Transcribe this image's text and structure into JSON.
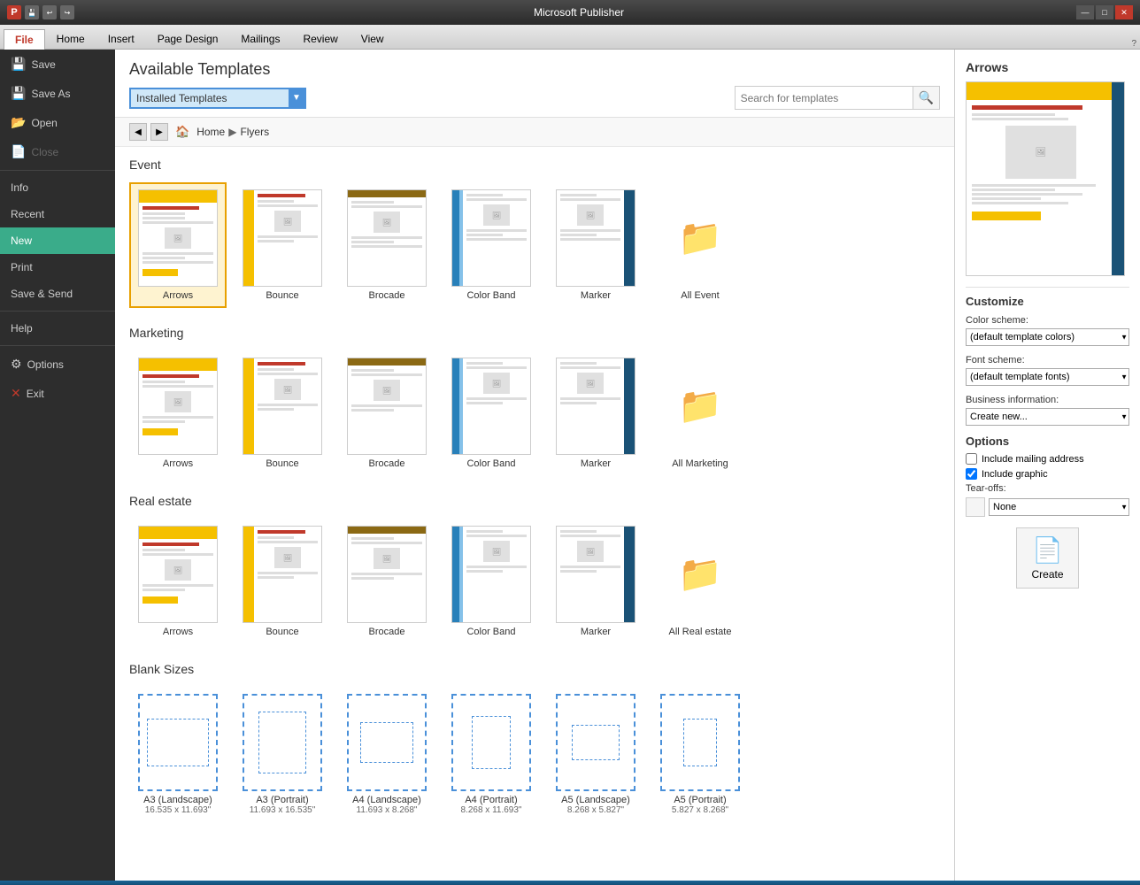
{
  "titlebar": {
    "title": "Microsoft Publisher",
    "app_icon": "P",
    "min_btn": "—",
    "max_btn": "□",
    "close_btn": "✕"
  },
  "ribbon": {
    "tabs": [
      "File",
      "Home",
      "Insert",
      "Page Design",
      "Mailings",
      "Review",
      "View"
    ]
  },
  "sidebar": {
    "items": [
      {
        "id": "save",
        "label": "Save",
        "icon": "💾"
      },
      {
        "id": "save-as",
        "label": "Save As",
        "icon": "💾"
      },
      {
        "id": "open",
        "label": "Open",
        "icon": "📂"
      },
      {
        "id": "close",
        "label": "Close",
        "icon": "📄"
      },
      {
        "id": "info",
        "label": "Info"
      },
      {
        "id": "recent",
        "label": "Recent"
      },
      {
        "id": "new",
        "label": "New",
        "active": true
      },
      {
        "id": "print",
        "label": "Print"
      },
      {
        "id": "save-send",
        "label": "Save & Send"
      },
      {
        "id": "help",
        "label": "Help"
      },
      {
        "id": "options",
        "label": "Options",
        "icon": "⚙"
      },
      {
        "id": "exit",
        "label": "Exit",
        "icon": "✕"
      }
    ]
  },
  "header": {
    "title": "Available Templates",
    "dropdown_selected": "Installed Templates",
    "search_placeholder": "Search for templates",
    "breadcrumb": {
      "home": "Home",
      "separator": "▶",
      "current": "Flyers"
    }
  },
  "categories": [
    {
      "id": "event",
      "label": "Event",
      "templates": [
        {
          "id": "arrows-e",
          "label": "Arrows",
          "type": "arrows",
          "selected": true
        },
        {
          "id": "bounce-e",
          "label": "Bounce",
          "type": "bounce"
        },
        {
          "id": "brocade-e",
          "label": "Brocade",
          "type": "brocade"
        },
        {
          "id": "colorband-e",
          "label": "Color Band",
          "type": "colorband"
        },
        {
          "id": "marker-e",
          "label": "Marker",
          "type": "marker"
        },
        {
          "id": "all-e",
          "label": "All Event",
          "type": "folder"
        }
      ]
    },
    {
      "id": "marketing",
      "label": "Marketing",
      "templates": [
        {
          "id": "arrows-m",
          "label": "Arrows",
          "type": "arrows"
        },
        {
          "id": "bounce-m",
          "label": "Bounce",
          "type": "bounce"
        },
        {
          "id": "brocade-m",
          "label": "Brocade",
          "type": "brocade"
        },
        {
          "id": "colorband-m",
          "label": "Color Band",
          "type": "colorband"
        },
        {
          "id": "marker-m",
          "label": "Marker",
          "type": "marker"
        },
        {
          "id": "all-m",
          "label": "All Marketing",
          "type": "folder"
        }
      ]
    },
    {
      "id": "realestate",
      "label": "Real estate",
      "templates": [
        {
          "id": "arrows-r",
          "label": "Arrows",
          "type": "arrows"
        },
        {
          "id": "bounce-r",
          "label": "Bounce",
          "type": "bounce"
        },
        {
          "id": "brocade-r",
          "label": "Brocade",
          "type": "brocade"
        },
        {
          "id": "colorband-r",
          "label": "Color Band",
          "type": "colorband"
        },
        {
          "id": "marker-r",
          "label": "Marker",
          "type": "marker"
        },
        {
          "id": "all-r",
          "label": "All Real estate",
          "type": "folder"
        }
      ]
    },
    {
      "id": "blank",
      "label": "Blank Sizes",
      "templates": [
        {
          "id": "a3-land",
          "label": "A3 (Landscape)",
          "sublabel": "16.535 x 11.693\"",
          "type": "blank-landscape"
        },
        {
          "id": "a3-port",
          "label": "A3 (Portrait)",
          "sublabel": "11.693 x 16.535\"",
          "type": "blank-portrait"
        },
        {
          "id": "a4-land",
          "label": "A4 (Landscape)",
          "sublabel": "11.693 x 8.268\"",
          "type": "blank-small-landscape"
        },
        {
          "id": "a4-port",
          "label": "A4 (Portrait)",
          "sublabel": "8.268 x 11.693\"",
          "type": "blank-small-portrait"
        },
        {
          "id": "a5-land",
          "label": "A5 (Landscape)",
          "sublabel": "8.268 x 5.827\"",
          "type": "blank-smaller-landscape"
        },
        {
          "id": "a5-port",
          "label": "A5 (Portrait)",
          "sublabel": "5.827 x 8.268\"",
          "type": "blank-smaller-portrait"
        }
      ]
    }
  ],
  "right_panel": {
    "title": "Arrows",
    "customize_title": "Customize",
    "color_scheme_label": "Color scheme:",
    "color_scheme_value": "(default template colors)",
    "font_scheme_label": "Font scheme:",
    "font_scheme_value": "(default template fonts)",
    "business_info_label": "Business information:",
    "business_info_value": "Create new...",
    "options_title": "Options",
    "include_mailing": "Include mailing address",
    "include_graphic": "Include graphic",
    "tearoffs_label": "Tear-offs:",
    "tearoffs_value": "None",
    "create_label": "Create"
  }
}
